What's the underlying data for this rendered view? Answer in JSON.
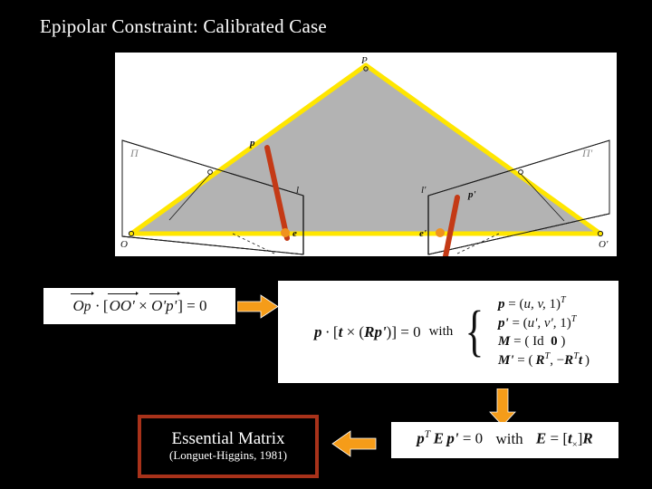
{
  "slide": {
    "background_color": "#000000",
    "title": "Epipolar Constraint: Calibrated Case"
  },
  "figure": {
    "name": "epipolar-geometry-diagram",
    "background_color": "#ffffff",
    "plane_fill": "#b3b3b3",
    "ray_color": "#ffe600",
    "epipolar_line_color": "#c43a16",
    "labels": {
      "scene_point": "P",
      "left_image_point": "p",
      "right_image_point": "p'",
      "left_epipolar_line": "l",
      "right_epipolar_line": "l'",
      "left_epipole": "e",
      "right_epipole": "e'",
      "left_center": "O",
      "right_center": "O'",
      "left_plane": "Π",
      "right_plane": "Π'"
    }
  },
  "equations": {
    "box1": {
      "name": "triple-product-equation",
      "parts": {
        "v1": "Op",
        "v2": "OO'",
        "v3": "O'p'",
        "dot": "·",
        "cross": "×",
        "open": "[",
        "close": "]",
        "equals": "= 0"
      }
    },
    "box2": {
      "name": "calibrated-epipolar-equation",
      "lhs_parts": {
        "p": "p",
        "dot": "·",
        "open": "[",
        "t": "t",
        "cross": "×",
        "paren_open": "(",
        "R": "R",
        "pprime": "p'",
        "paren_close": ")",
        "close": "]",
        "equals": "= 0"
      },
      "with_label": "with",
      "rows": [
        "p = (u, v, 1)T",
        "p' = (u', v', 1)T",
        "M = ( Id  0 )",
        "M' = ( RT, −RT t )"
      ],
      "rows_parts": [
        {
          "lhs": "p",
          "rhs_open": "= (",
          "rhs": "u, v, 1",
          "rhs_close": ")",
          "sup": "T"
        },
        {
          "lhs": "p'",
          "rhs_open": "= (",
          "rhs": "u', v', 1",
          "rhs_close": ")",
          "sup": "T"
        },
        {
          "lhs": "M",
          "rhs_open": "= (",
          "rhs": "Id  0",
          "rhs_close": ")",
          "sup": ""
        },
        {
          "lhs": "M'",
          "rhs_open": "= (",
          "rhs": "RT, −RT t",
          "rhs_close": ")",
          "sup": ""
        }
      ]
    },
    "box3": {
      "name": "essential-matrix-equation",
      "lhs": "pT E p' = 0",
      "with_label": "with",
      "rhs": "E = [t×] R"
    }
  },
  "callout": {
    "name": "essential-matrix-callout",
    "title": "Essential Matrix",
    "citation": "(Longuet-Higgins, 1981)",
    "border_color": "#a8321a",
    "text_color": "#ffffff"
  },
  "arrows": {
    "color": "#f59c19",
    "right": "arrow-right-icon",
    "down": "arrow-down-icon",
    "left": "arrow-left-icon"
  }
}
